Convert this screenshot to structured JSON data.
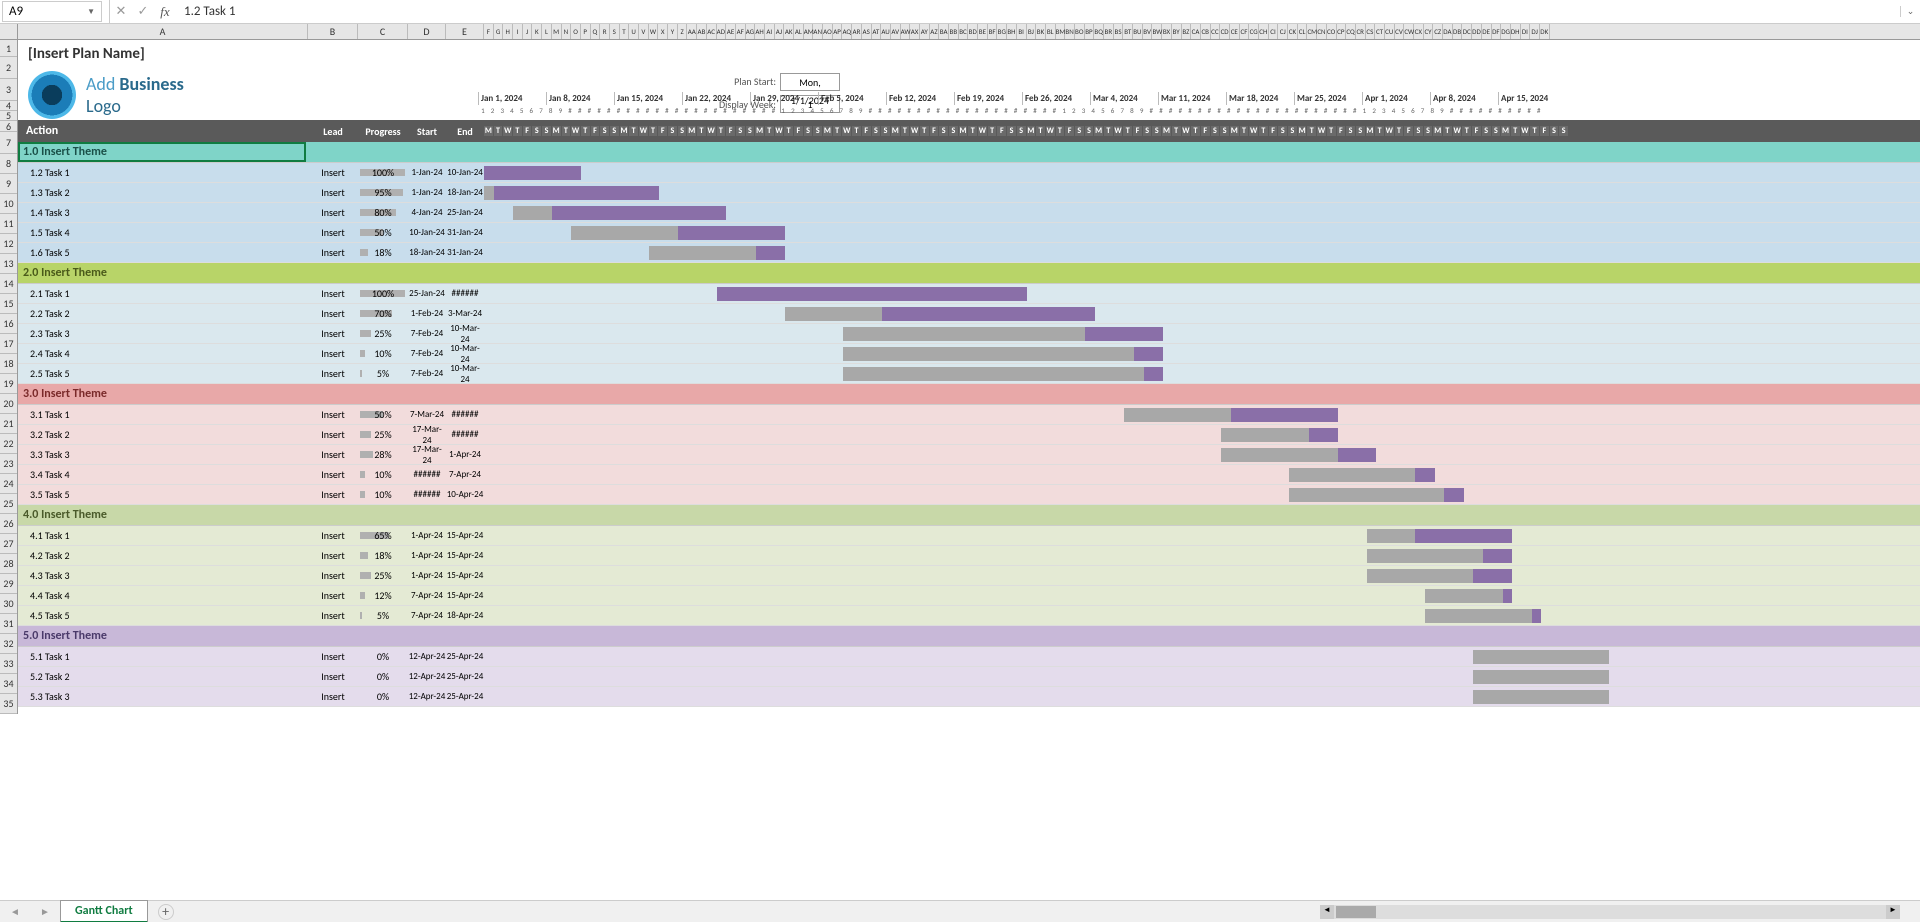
{
  "nameBox": "A9",
  "formulaValue": "1.2 Task 1",
  "planName": "[Insert Plan Name]",
  "logoText": {
    "add": "Add",
    "biz": "Business",
    "lg": "Logo"
  },
  "planStartLabel": "Plan Start:",
  "displayWeekLabel": "Display Week:",
  "planStartValue": "Mon, 1/1/2024",
  "displayWeekValue": "1",
  "headers": {
    "action": "Action",
    "lead": "Lead",
    "progress": "Progress",
    "start": "Start",
    "end": "End"
  },
  "colLetters": [
    "A",
    "B",
    "C",
    "D",
    "E",
    "F",
    "G",
    "H",
    "I",
    "J",
    "K",
    "L",
    "M",
    "N",
    "O",
    "P",
    "Q",
    "R",
    "S",
    "T",
    "U",
    "V",
    "W",
    "X",
    "Y",
    "Z",
    "AA",
    "AB",
    "AC",
    "AD",
    "AE",
    "AF",
    "AG",
    "AH",
    "AI",
    "AJ",
    "AK",
    "AL",
    "AM",
    "AN",
    "AO",
    "AP",
    "AQ",
    "AR",
    "AS",
    "AT",
    "AU",
    "AV",
    "AW",
    "AX",
    "AY",
    "AZ",
    "BA",
    "BB",
    "BC",
    "BD",
    "BE",
    "BF",
    "BG",
    "BH",
    "BI",
    "BJ",
    "BK",
    "BL",
    "BM",
    "BN",
    "BO",
    "BP",
    "BQ",
    "BR",
    "BS",
    "BT",
    "BU",
    "BV",
    "BW",
    "BX",
    "BY",
    "BZ",
    "CA",
    "CB",
    "CC",
    "CD",
    "CE",
    "CF",
    "CG",
    "CH",
    "CI",
    "CJ",
    "CK",
    "CL",
    "CM",
    "CN",
    "CO",
    "CP",
    "CQ",
    "CR",
    "CS",
    "CT",
    "CU",
    "CV",
    "CW",
    "CX",
    "CY",
    "CZ",
    "DA",
    "DB",
    "DC",
    "DD",
    "DE",
    "DF",
    "DG",
    "DH",
    "DI",
    "DJ",
    "DK"
  ],
  "weekDates": [
    "Jan 1, 2024",
    "Jan 8, 2024",
    "Jan 15, 2024",
    "Jan 22, 2024",
    "Jan 29, 2024",
    "Feb 5, 2024",
    "Feb 12, 2024",
    "Feb 19, 2024",
    "Feb 26, 2024",
    "Mar 4, 2024",
    "Mar 11, 2024",
    "Mar 18, 2024",
    "Mar 25, 2024",
    "Apr 1, 2024",
    "Apr 8, 2024",
    "Apr 15, 2024"
  ],
  "dayNums": [
    "1",
    "2",
    "3",
    "4",
    "5",
    "6",
    "7",
    "8",
    "9",
    "#",
    "#",
    "#",
    "#",
    "#",
    "#",
    "#",
    "#",
    "#",
    "#",
    "#",
    "#",
    "#",
    "#",
    "#",
    "#",
    "#",
    "#",
    "#",
    "#",
    "#",
    "#",
    "1",
    "2",
    "3",
    "4",
    "5",
    "6",
    "7",
    "8",
    "9",
    "#",
    "#",
    "#",
    "#",
    "#",
    "#",
    "#",
    "#",
    "#",
    "#",
    "#",
    "#",
    "#",
    "#",
    "#",
    "#",
    "#",
    "#",
    "#",
    "#",
    "1",
    "2",
    "3",
    "4",
    "5",
    "6",
    "7",
    "8",
    "9",
    "#",
    "#",
    "#",
    "#",
    "#",
    "#",
    "#",
    "#",
    "#",
    "#",
    "#",
    "#",
    "#",
    "#",
    "#",
    "#",
    "#",
    "#",
    "#",
    "#",
    "#",
    "#",
    "1",
    "2",
    "3",
    "4",
    "5",
    "6",
    "7",
    "8",
    "9",
    "#",
    "#",
    "#",
    "#",
    "#",
    "#",
    "#",
    "#",
    "#",
    "#"
  ],
  "dayLetters": [
    "M",
    "T",
    "W",
    "T",
    "F",
    "S",
    "S"
  ],
  "themes": [
    {
      "title": "1.0 Insert Theme",
      "class": "theme-1",
      "bg": "bg1",
      "tasks": [
        {
          "name": "1.2 Task 1",
          "lead": "Insert",
          "prog": "100%",
          "progW": 100,
          "start": "1-Jan-24",
          "end": "10-Jan-24",
          "barStart": 0,
          "barLen": 10,
          "done": 10
        },
        {
          "name": "1.3 Task 2",
          "lead": "Insert",
          "prog": "95%",
          "progW": 95,
          "start": "1-Jan-24",
          "end": "18-Jan-24",
          "barStart": 0,
          "barLen": 18,
          "done": 17
        },
        {
          "name": "1.4 Task 3",
          "lead": "Insert",
          "prog": "80%",
          "progW": 80,
          "start": "4-Jan-24",
          "end": "25-Jan-24",
          "barStart": 3,
          "barLen": 22,
          "done": 18
        },
        {
          "name": "1.5 Task 4",
          "lead": "Insert",
          "prog": "50%",
          "progW": 50,
          "start": "10-Jan-24",
          "end": "31-Jan-24",
          "barStart": 9,
          "barLen": 22,
          "done": 11
        },
        {
          "name": "1.6 Task 5",
          "lead": "Insert",
          "prog": "18%",
          "progW": 18,
          "start": "18-Jan-24",
          "end": "31-Jan-24",
          "barStart": 17,
          "barLen": 14,
          "done": 3
        }
      ]
    },
    {
      "title": "2.0 Insert Theme",
      "class": "theme-2",
      "bg": "bg2",
      "tasks": [
        {
          "name": "2.1 Task 1",
          "lead": "Insert",
          "prog": "100%",
          "progW": 100,
          "start": "25-Jan-24",
          "end": "######",
          "barStart": 24,
          "barLen": 32,
          "done": 32
        },
        {
          "name": "2.2 Task 2",
          "lead": "Insert",
          "prog": "70%",
          "progW": 70,
          "start": "1-Feb-24",
          "end": "3-Mar-24",
          "barStart": 31,
          "barLen": 32,
          "done": 22
        },
        {
          "name": "2.3 Task 3",
          "lead": "Insert",
          "prog": "25%",
          "progW": 25,
          "start": "7-Feb-24",
          "end": "10-Mar-24",
          "barStart": 37,
          "barLen": 33,
          "done": 8
        },
        {
          "name": "2.4 Task 4",
          "lead": "Insert",
          "prog": "10%",
          "progW": 10,
          "start": "7-Feb-24",
          "end": "10-Mar-24",
          "barStart": 37,
          "barLen": 33,
          "done": 3
        },
        {
          "name": "2.5 Task 5",
          "lead": "Insert",
          "prog": "5%",
          "progW": 5,
          "start": "7-Feb-24",
          "end": "10-Mar-24",
          "barStart": 37,
          "barLen": 33,
          "done": 2
        }
      ]
    },
    {
      "title": "3.0 Insert Theme",
      "class": "theme-3",
      "bg": "bg3",
      "tasks": [
        {
          "name": "3.1 Task 1",
          "lead": "Insert",
          "prog": "50%",
          "progW": 50,
          "start": "7-Mar-24",
          "end": "######",
          "barStart": 66,
          "barLen": 22,
          "done": 11
        },
        {
          "name": "3.2 Task 2",
          "lead": "Insert",
          "prog": "25%",
          "progW": 25,
          "start": "17-Mar-24",
          "end": "######",
          "barStart": 76,
          "barLen": 12,
          "done": 3
        },
        {
          "name": "3.3 Task 3",
          "lead": "Insert",
          "prog": "28%",
          "progW": 28,
          "start": "17-Mar-24",
          "end": "1-Apr-24",
          "barStart": 76,
          "barLen": 16,
          "done": 4
        },
        {
          "name": "3.4 Task 4",
          "lead": "Insert",
          "prog": "10%",
          "progW": 10,
          "start": "######",
          "end": "7-Apr-24",
          "barStart": 83,
          "barLen": 15,
          "done": 2
        },
        {
          "name": "3.5 Task 5",
          "lead": "Insert",
          "prog": "10%",
          "progW": 10,
          "start": "######",
          "end": "10-Apr-24",
          "barStart": 83,
          "barLen": 18,
          "done": 2
        }
      ]
    },
    {
      "title": "4.0 Insert Theme",
      "class": "theme-4",
      "bg": "bg4",
      "tasks": [
        {
          "name": "4.1 Task 1",
          "lead": "Insert",
          "prog": "65%",
          "progW": 65,
          "start": "1-Apr-24",
          "end": "15-Apr-24",
          "barStart": 91,
          "barLen": 15,
          "done": 10
        },
        {
          "name": "4.2 Task 2",
          "lead": "Insert",
          "prog": "18%",
          "progW": 18,
          "start": "1-Apr-24",
          "end": "15-Apr-24",
          "barStart": 91,
          "barLen": 15,
          "done": 3
        },
        {
          "name": "4.3 Task 3",
          "lead": "Insert",
          "prog": "25%",
          "progW": 25,
          "start": "1-Apr-24",
          "end": "15-Apr-24",
          "barStart": 91,
          "barLen": 15,
          "done": 4
        },
        {
          "name": "4.4 Task 4",
          "lead": "Insert",
          "prog": "12%",
          "progW": 12,
          "start": "7-Apr-24",
          "end": "15-Apr-24",
          "barStart": 97,
          "barLen": 9,
          "done": 1
        },
        {
          "name": "4.5 Task 5",
          "lead": "Insert",
          "prog": "5%",
          "progW": 5,
          "start": "7-Apr-24",
          "end": "18-Apr-24",
          "barStart": 97,
          "barLen": 12,
          "done": 1
        }
      ]
    },
    {
      "title": "5.0 Insert Theme",
      "class": "theme-5",
      "bg": "bg5",
      "tasks": [
        {
          "name": "5.1 Task 1",
          "lead": "Insert",
          "prog": "0%",
          "progW": 0,
          "start": "12-Apr-24",
          "end": "25-Apr-24",
          "barStart": 102,
          "barLen": 14,
          "done": 0
        },
        {
          "name": "5.2 Task 2",
          "lead": "Insert",
          "prog": "0%",
          "progW": 0,
          "start": "12-Apr-24",
          "end": "25-Apr-24",
          "barStart": 102,
          "barLen": 14,
          "done": 0
        },
        {
          "name": "5.3 Task 3",
          "lead": "Insert",
          "prog": "0%",
          "progW": 0,
          "start": "12-Apr-24",
          "end": "25-Apr-24",
          "barStart": 102,
          "barLen": 14,
          "done": 0
        }
      ]
    }
  ],
  "sheetTab": "Gantt Chart",
  "rowNums": [
    "1",
    "2",
    "3",
    "4",
    "5",
    "6",
    "7",
    "8",
    "9",
    "10",
    "11",
    "12",
    "13",
    "14",
    "15",
    "16",
    "17",
    "18",
    "19",
    "20",
    "21",
    "22",
    "23",
    "24",
    "25",
    "26",
    "27",
    "28",
    "29",
    "30",
    "31",
    "32",
    "33",
    "34",
    "35"
  ],
  "chart_data": {
    "type": "gantt",
    "title": "[Insert Plan Name]",
    "plan_start": "2024-01-01",
    "display_week": 1,
    "x_axis_weeks": [
      "2024-01-01",
      "2024-01-08",
      "2024-01-15",
      "2024-01-22",
      "2024-01-29",
      "2024-02-05",
      "2024-02-12",
      "2024-02-19",
      "2024-02-26",
      "2024-03-04",
      "2024-03-11",
      "2024-03-18",
      "2024-03-25",
      "2024-04-01",
      "2024-04-08",
      "2024-04-15"
    ],
    "series": [
      {
        "group": "1.0 Insert Theme",
        "task": "1.2 Task 1",
        "lead": "Insert",
        "progress_pct": 100,
        "start": "2024-01-01",
        "end": "2024-01-10"
      },
      {
        "group": "1.0 Insert Theme",
        "task": "1.3 Task 2",
        "lead": "Insert",
        "progress_pct": 95,
        "start": "2024-01-01",
        "end": "2024-01-18"
      },
      {
        "group": "1.0 Insert Theme",
        "task": "1.4 Task 3",
        "lead": "Insert",
        "progress_pct": 80,
        "start": "2024-01-04",
        "end": "2024-01-25"
      },
      {
        "group": "1.0 Insert Theme",
        "task": "1.5 Task 4",
        "lead": "Insert",
        "progress_pct": 50,
        "start": "2024-01-10",
        "end": "2024-01-31"
      },
      {
        "group": "1.0 Insert Theme",
        "task": "1.6 Task 5",
        "lead": "Insert",
        "progress_pct": 18,
        "start": "2024-01-18",
        "end": "2024-01-31"
      },
      {
        "group": "2.0 Insert Theme",
        "task": "2.1 Task 1",
        "lead": "Insert",
        "progress_pct": 100,
        "start": "2024-01-25",
        "end": "2024-02-25"
      },
      {
        "group": "2.0 Insert Theme",
        "task": "2.2 Task 2",
        "lead": "Insert",
        "progress_pct": 70,
        "start": "2024-02-01",
        "end": "2024-03-03"
      },
      {
        "group": "2.0 Insert Theme",
        "task": "2.3 Task 3",
        "lead": "Insert",
        "progress_pct": 25,
        "start": "2024-02-07",
        "end": "2024-03-10"
      },
      {
        "group": "2.0 Insert Theme",
        "task": "2.4 Task 4",
        "lead": "Insert",
        "progress_pct": 10,
        "start": "2024-02-07",
        "end": "2024-03-10"
      },
      {
        "group": "2.0 Insert Theme",
        "task": "2.5 Task 5",
        "lead": "Insert",
        "progress_pct": 5,
        "start": "2024-02-07",
        "end": "2024-03-10"
      },
      {
        "group": "3.0 Insert Theme",
        "task": "3.1 Task 1",
        "lead": "Insert",
        "progress_pct": 50,
        "start": "2024-03-07",
        "end": "2024-03-28"
      },
      {
        "group": "3.0 Insert Theme",
        "task": "3.2 Task 2",
        "lead": "Insert",
        "progress_pct": 25,
        "start": "2024-03-17",
        "end": "2024-03-28"
      },
      {
        "group": "3.0 Insert Theme",
        "task": "3.3 Task 3",
        "lead": "Insert",
        "progress_pct": 28,
        "start": "2024-03-17",
        "end": "2024-04-01"
      },
      {
        "group": "3.0 Insert Theme",
        "task": "3.4 Task 4",
        "lead": "Insert",
        "progress_pct": 10,
        "start": "2024-03-24",
        "end": "2024-04-07"
      },
      {
        "group": "3.0 Insert Theme",
        "task": "3.5 Task 5",
        "lead": "Insert",
        "progress_pct": 10,
        "start": "2024-03-24",
        "end": "2024-04-10"
      },
      {
        "group": "4.0 Insert Theme",
        "task": "4.1 Task 1",
        "lead": "Insert",
        "progress_pct": 65,
        "start": "2024-04-01",
        "end": "2024-04-15"
      },
      {
        "group": "4.0 Insert Theme",
        "task": "4.2 Task 2",
        "lead": "Insert",
        "progress_pct": 18,
        "start": "2024-04-01",
        "end": "2024-04-15"
      },
      {
        "group": "4.0 Insert Theme",
        "task": "4.3 Task 3",
        "lead": "Insert",
        "progress_pct": 25,
        "start": "2024-04-01",
        "end": "2024-04-15"
      },
      {
        "group": "4.0 Insert Theme",
        "task": "4.4 Task 4",
        "lead": "Insert",
        "progress_pct": 12,
        "start": "2024-04-07",
        "end": "2024-04-15"
      },
      {
        "group": "4.0 Insert Theme",
        "task": "4.5 Task 5",
        "lead": "Insert",
        "progress_pct": 5,
        "start": "2024-04-07",
        "end": "2024-04-18"
      },
      {
        "group": "5.0 Insert Theme",
        "task": "5.1 Task 1",
        "lead": "Insert",
        "progress_pct": 0,
        "start": "2024-04-12",
        "end": "2024-04-25"
      },
      {
        "group": "5.0 Insert Theme",
        "task": "5.2 Task 2",
        "lead": "Insert",
        "progress_pct": 0,
        "start": "2024-04-12",
        "end": "2024-04-25"
      },
      {
        "group": "5.0 Insert Theme",
        "task": "5.3 Task 3",
        "lead": "Insert",
        "progress_pct": 0,
        "start": "2024-04-12",
        "end": "2024-04-25"
      }
    ]
  }
}
